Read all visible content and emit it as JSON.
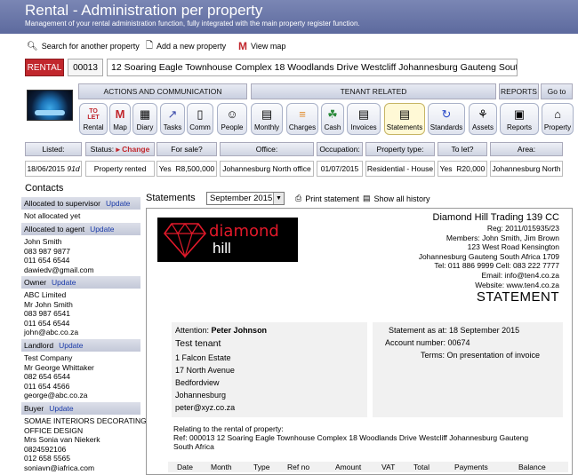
{
  "header": {
    "title": "Rental - Administration per property",
    "subtitle": "Management of your rental administration function, fully integrated with the main property register function."
  },
  "links": {
    "search": "Search for another property",
    "add": "Add a new property",
    "map": "View map"
  },
  "property": {
    "tag": "RENTAL",
    "id": "00013",
    "address": "12 Soaring Eagle Townhouse Complex 18 Woodlands Drive Westcliff Johannesburg Gauteng South Africa"
  },
  "sections": {
    "actions": "ACTIONS AND COMMUNICATION",
    "tenant": "TENANT RELATED",
    "reports": "REPORTS",
    "goto": "Go to"
  },
  "nav": [
    {
      "label": "Rental",
      "icon": "to-let-icon"
    },
    {
      "label": "Map",
      "icon": "map-icon"
    },
    {
      "label": "Diary",
      "icon": "diary-icon"
    },
    {
      "label": "Tasks",
      "icon": "tasks-icon"
    },
    {
      "label": "Comm",
      "icon": "comm-icon"
    },
    {
      "label": "People",
      "icon": "people-icon"
    },
    {
      "label": "Monthly",
      "icon": "monthly-icon"
    },
    {
      "label": "Charges",
      "icon": "charges-icon"
    },
    {
      "label": "Cash",
      "icon": "cash-icon"
    },
    {
      "label": "Invoices",
      "icon": "invoices-icon"
    },
    {
      "label": "Statements",
      "icon": "statements-icon"
    },
    {
      "label": "Standards",
      "icon": "standards-icon"
    },
    {
      "label": "Assets",
      "icon": "assets-icon"
    },
    {
      "label": "Reports",
      "icon": "reports-icon"
    },
    {
      "label": "Property",
      "icon": "home-icon"
    }
  ],
  "info": {
    "listed_label": "Listed:",
    "listed_value": "18/06/2015",
    "listed_days": "91d",
    "status_label": "Status:",
    "status_change": "Change",
    "status_value": "Property rented",
    "forsale_label": "For sale?",
    "forsale_yes": "Yes",
    "forsale_value": "R8,500,000",
    "office_label": "Office:",
    "office_value": "Johannesburg North office",
    "occupation_label": "Occupation:",
    "occupation_value": "01/07/2015",
    "type_label": "Property type:",
    "type_value": "Residential - House",
    "tolet_label": "To let?",
    "tolet_yes": "Yes",
    "tolet_value": "R20,000",
    "area_label": "Area:",
    "area_value": "Johannesburg North"
  },
  "contacts": {
    "title": "Contacts",
    "update": "Update",
    "supervisor_header": "Allocated to supervisor",
    "supervisor_lines": [
      "Not allocated yet"
    ],
    "agent_header": "Allocated to agent",
    "agent_lines": [
      "John Smith",
      "083 987 9877",
      "011 654 6544",
      "dawiedv@gmail.com"
    ],
    "owner_header": "Owner",
    "owner_lines": [
      "ABC Limited",
      "Mr John Smith",
      "083 987 6541",
      "011 654 6544",
      "john@abc.co.za"
    ],
    "landlord_header": "Landlord",
    "landlord_lines": [
      "Test Company",
      "Mr George Whittaker",
      "082 654 6544",
      "011 654 4566",
      "george@abc.co.za"
    ],
    "buyer_header": "Buyer",
    "buyer_lines": [
      "SOMAE INTERIORS DECORATING &",
      "OFFICE DESIGN",
      "Mrs Sonia van Niekerk",
      "0824592106",
      "012 658 5565",
      "soniavn@iafrica.com"
    ]
  },
  "statements": {
    "label": "Statements",
    "month": "September 2015",
    "print": "Print statement",
    "history": "Show all history"
  },
  "document": {
    "logo_top": "diamond",
    "logo_bottom": "hill",
    "company": "Diamond Hill Trading 139 CC",
    "details": [
      "Reg: 2011/015935/23",
      "Members: John Smith, Jim Brown",
      "123 West Road Kensington",
      "Johannesburg Gauteng South Africa 1709",
      "Tel: 011 886 9999  Cell: 083 222 7777",
      "Email: info@ten4.co.za",
      "Website: www.ten4.co.za"
    ],
    "heading": "STATEMENT",
    "attention_label": "Attention:",
    "attention_name": "Peter Johnson",
    "tenant_lines": [
      "Test tenant",
      "1 Falcon Estate",
      "17 North Avenue",
      "Bedfordview",
      "Johannesburg",
      "peter@xyz.co.za"
    ],
    "statement_as_at": "Statement as at: 18 September 2015",
    "account_number": "Account number: 00674",
    "terms": "Terms: On presentation of invoice",
    "relating": "Relating to the rental of property:",
    "ref": "Ref: 000013    12 Soaring Eagle Townhouse Complex 18 Woodlands Drive Westcliff Johannesburg Gauteng South Africa",
    "columns": [
      "Date",
      "Month",
      "Type",
      "Ref no",
      "Amount",
      "VAT",
      "Total",
      "Payments",
      "Balance"
    ]
  },
  "colors": {
    "header_bg": "#5d6a9e",
    "rental_tag": "#c1272d",
    "link_blue": "#1a3aa8",
    "active_nav": "#fff9d6"
  }
}
